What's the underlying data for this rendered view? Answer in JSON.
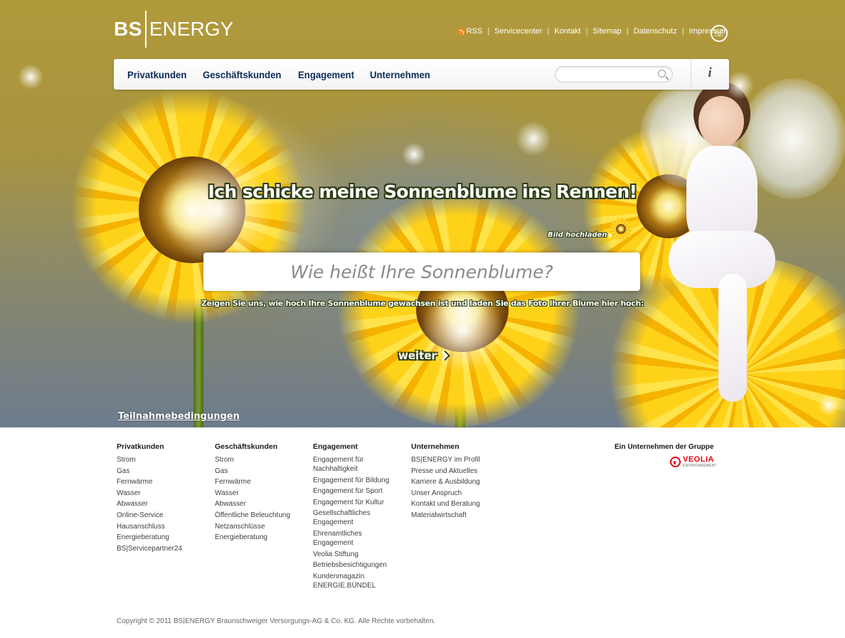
{
  "brand": {
    "logo_bs": "BS",
    "logo_energy": "ENERGY"
  },
  "topnav": {
    "items": [
      "RSS",
      "Servicecenter",
      "Kontakt",
      "Sitemap",
      "Datenschutz",
      "Impressum"
    ],
    "separator": "|"
  },
  "mainnav": {
    "items": [
      "Privatkunden",
      "Geschäftskunden",
      "Engagement",
      "Unternehmen"
    ],
    "search": {
      "value": "",
      "placeholder": ""
    }
  },
  "campaign": {
    "headline": "Ich schicke meine Sonnenblume ins Rennen!",
    "upload_label": "Bild hochladen",
    "name_field_placeholder": "Wie heißt Ihre Sonnenblume?",
    "instruction": "Zeigen Sie uns, wie hoch Ihre Sonnenblume gewachsen ist und laden Sie das Foto Ihrer Blume hier hoch:",
    "next_label": "weiter",
    "terms_link": "Teilnahmebedingungen"
  },
  "footer": {
    "columns": [
      {
        "title": "Privatkunden",
        "links": [
          "Strom",
          "Gas",
          "Fernwärme",
          "Wasser",
          "Abwasser",
          "Online-Service",
          "Hausanschluss",
          "Energieberatung",
          "BS|Servicepartner24"
        ]
      },
      {
        "title": "Geschäftskunden",
        "links": [
          "Strom",
          "Gas",
          "Fernwärme",
          "Wasser",
          "Abwasser",
          "Öffentliche Beleuchtung",
          "Netzanschlüsse",
          "Energieberatung"
        ]
      },
      {
        "title": "Engagement",
        "links": [
          "Engagement für Nachhaltigkeit",
          "Engagement für Bildung",
          "Engagement für Sport",
          "Engagement für Kultur",
          "Gesellschaftliches Engagement",
          "Ehrenamtliches Engagement",
          "Veolia Stiftung",
          "Betriebsbesichtigungen",
          "Kundenmagazin ENERGIE.BÜNDEL"
        ]
      },
      {
        "title": "Unternehmen",
        "links": [
          "BS|ENERGY im Profil",
          "Presse und Aktuelles",
          "Karriere & Ausbildung",
          "Unser Anspruch",
          "Kontakt und Beratung",
          "Materialwirtschaft"
        ]
      }
    ],
    "group_label": "Ein Unternehmen der Gruppe",
    "veolia_name": "VEOLIA",
    "veolia_sub": "ENVIRONNEMENT",
    "copyright": "Copyright © 2011 BS|ENERGY Braunschweiger Versorgungs-AG & Co. KG. Alle Rechte vorbehalten."
  },
  "colors": {
    "nav_text": "#0d2c5a",
    "hero_outline": "#2d3d14",
    "veolia_red": "#e30613"
  },
  "icons": [
    "rss-icon",
    "phone-icon",
    "search-icon",
    "info-icon",
    "chevron-right-icon",
    "veolia-logo-icon"
  ]
}
